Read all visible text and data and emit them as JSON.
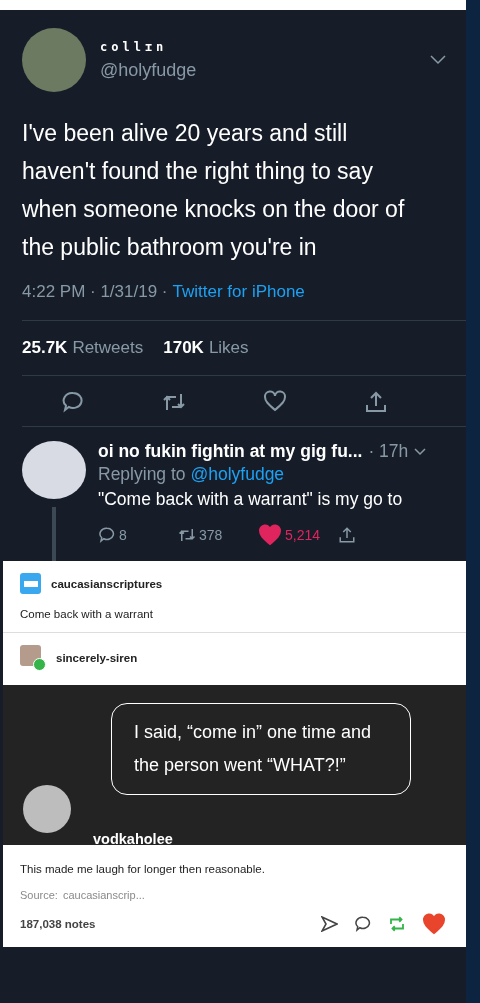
{
  "tweet": {
    "display_name": "collɪn",
    "handle": "@holyfudge",
    "text": "I've been alive 20 years and still haven't found the right thing to say when someone knocks on the door of the public bathroom you're in",
    "timestamp": "4:22 PM · 1/31/19 ·",
    "source": "Twitter for iPhone",
    "retweets": "25.7K",
    "retweets_label": "Retweets",
    "likes": "170K",
    "likes_label": "Likes",
    "liked": false
  },
  "reply": {
    "display_name": "oi no fukin fightin at my gig fu...",
    "time": "· 17h",
    "replying_label": "Replying to",
    "replying_to": "@holyfudge",
    "text": "\"Come back with a warrant\" is my go to",
    "replies": "8",
    "retweets": "378",
    "likes": "5,214",
    "liked": true
  },
  "tumblr": {
    "original": {
      "username": "caucasianscriptures",
      "text": "Come back with a warrant"
    },
    "reblogger": {
      "username": "sincerely-siren"
    },
    "image_post": {
      "caption": "I said, “come in” one time and the person went “WHAT?!”",
      "username": "vodkaholee"
    },
    "comment": "This made me laugh for longer then reasonable.",
    "source_label": "Source:",
    "source": "caucasianscrip...",
    "notes": "187,038 notes",
    "reblogged": true,
    "liked": true
  }
}
